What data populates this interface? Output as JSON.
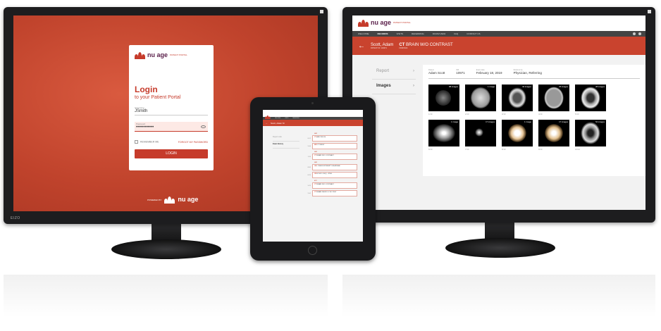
{
  "login": {
    "logo_text": "nu age",
    "logo_sub": "PATIENT PORTAL",
    "title": "Login",
    "subtitle": "to your Patient Portal",
    "username_label": "Username",
    "username_value": "JSmith",
    "password_label": "Password",
    "password_value": "••••••••••••",
    "remember_label": "REMEMBER ME",
    "forgot_label": "FORGOT MY PASSWORD",
    "login_button": "LOGIN",
    "powered_by": "POWERED BY"
  },
  "monitor_brand": "EIZO",
  "viewer": {
    "nav": [
      "WELCOME",
      "RECORDS",
      "VISITS",
      "REFERRING",
      "DICOM VIEW",
      "FAQ",
      "CONTACT US"
    ],
    "nav_active": 1,
    "patient_name": "Scott, Adam",
    "patient_sub": "PATIENT ID: 100971",
    "study_modality": "CT",
    "study_name": "BRAIN W/O CONTRAST",
    "study_sub": "FINDINGS",
    "sidebar": [
      {
        "label": "Report",
        "active": false
      },
      {
        "label": "Images",
        "active": true
      }
    ],
    "meta": [
      {
        "label": "Patient",
        "value": "Adam Scott"
      },
      {
        "label": "ID#",
        "value": "10971"
      },
      {
        "label": "Exam date",
        "value": "February 18, 2019"
      },
      {
        "label": "Referred by",
        "value": "Physician, Referring"
      }
    ],
    "thumbnails": [
      {
        "count": "88 images",
        "series": "1/10"
      },
      {
        "count": "1 image",
        "series": "2/10"
      },
      {
        "count": "32 images",
        "series": "3/10"
      },
      {
        "count": "25 images",
        "series": "4/10"
      },
      {
        "count": "28 images",
        "series": "5/10"
      },
      {
        "count": "1 image",
        "series": "6/10"
      },
      {
        "count": "17 images",
        "series": "7/10"
      },
      {
        "count": "1 image",
        "series": "8/10"
      },
      {
        "count": "17 images",
        "series": "9/10"
      },
      {
        "count": "54 images",
        "series": "10/10"
      }
    ]
  },
  "tablet": {
    "patient_name": "Scott, Adam M",
    "sidebar": [
      "Report Lists",
      "Exam history"
    ],
    "entries": [
      {
        "date": "MAR",
        "time": "09:12",
        "mod": "CT",
        "name": "ABD PELVIS"
      },
      {
        "date": "",
        "time": "10:04",
        "mod": "MR",
        "name": "CT WRIST"
      },
      {
        "date": "MAR",
        "time": "11:30",
        "mod": "CT",
        "name": "BRAIN W/O CONTRAST"
      },
      {
        "date": "MAR",
        "time": "08:45",
        "mod": "US",
        "name": "LOWER EXTREMITY BILATERAL"
      },
      {
        "date": "",
        "time": "09:20",
        "mod": "US",
        "name": "ECHO LOGIQ - JPEG"
      },
      {
        "date": "APR",
        "time": "14:10",
        "mod": "CT",
        "name": "BRAIN W/O CONTRAST"
      },
      {
        "date": "",
        "time": "15:02",
        "mod": "CT",
        "name": "BRAIN W&W/O IV NO TEST"
      }
    ]
  }
}
